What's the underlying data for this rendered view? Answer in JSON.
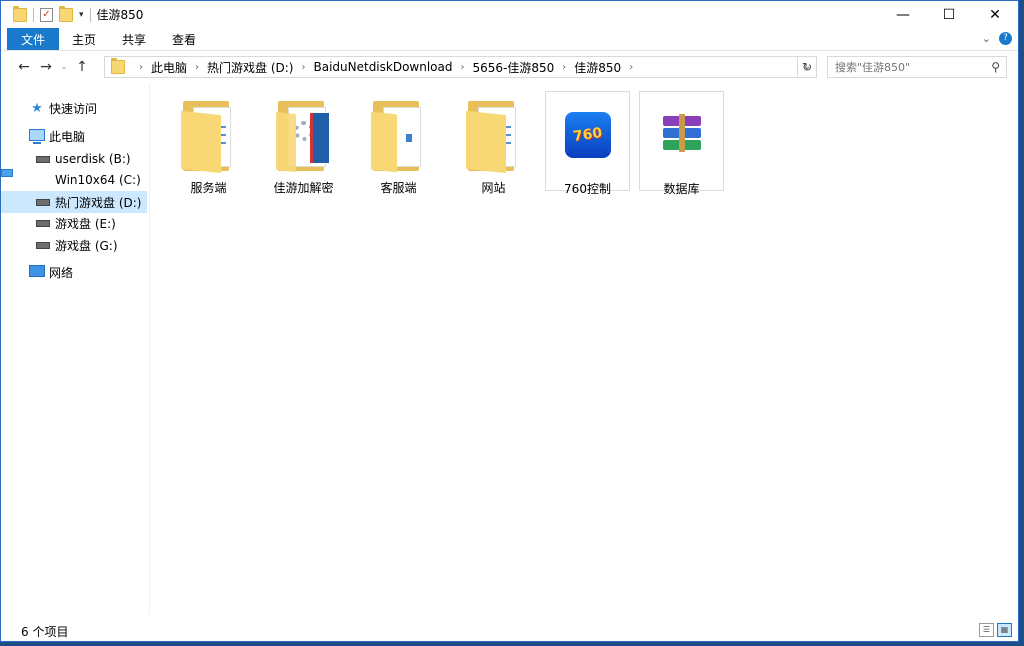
{
  "window": {
    "title": "佳游850",
    "controls": {
      "minimize": "—",
      "maximize": "☐",
      "close": "✕"
    }
  },
  "ribbon": {
    "tabs": [
      {
        "label": "文件"
      },
      {
        "label": "主页"
      },
      {
        "label": "共享"
      },
      {
        "label": "查看"
      }
    ]
  },
  "address": {
    "crumbs": [
      "此电脑",
      "热门游戏盘 (D:)",
      "BaiduNetdiskDownload",
      "5656-佳游850",
      "佳游850"
    ]
  },
  "search": {
    "placeholder": "搜索\"佳游850\""
  },
  "sidebar": {
    "items": [
      {
        "label": "快速访问",
        "icon": "star-icon"
      },
      {
        "label": "此电脑",
        "icon": "pc-icon"
      },
      {
        "label": "userdisk (B:)",
        "icon": "drive-icon"
      },
      {
        "label": "Win10x64 (C:)",
        "icon": "windows-drive-icon"
      },
      {
        "label": "热门游戏盘 (D:)",
        "icon": "drive-icon",
        "selected": true
      },
      {
        "label": "游戏盘 (E:)",
        "icon": "drive-icon"
      },
      {
        "label": "游戏盘 (G:)",
        "icon": "drive-icon"
      },
      {
        "label": "网络",
        "icon": "network-icon"
      }
    ]
  },
  "files": [
    {
      "label": "服务端",
      "icon": "folder-icon"
    },
    {
      "label": "佳游加解密",
      "icon": "folder-tools-icon"
    },
    {
      "label": "客服端",
      "icon": "folder-icon"
    },
    {
      "label": "网站",
      "icon": "folder-icon"
    },
    {
      "label": "760控制",
      "icon": "app-icon",
      "icon_text": "760"
    },
    {
      "label": "数据库",
      "icon": "winrar-archive-icon"
    }
  ],
  "status": {
    "count": "6 个项目"
  },
  "colors": {
    "accent": "#1979ca",
    "selected": "#cce8ff",
    "folder": "#f8d775"
  }
}
